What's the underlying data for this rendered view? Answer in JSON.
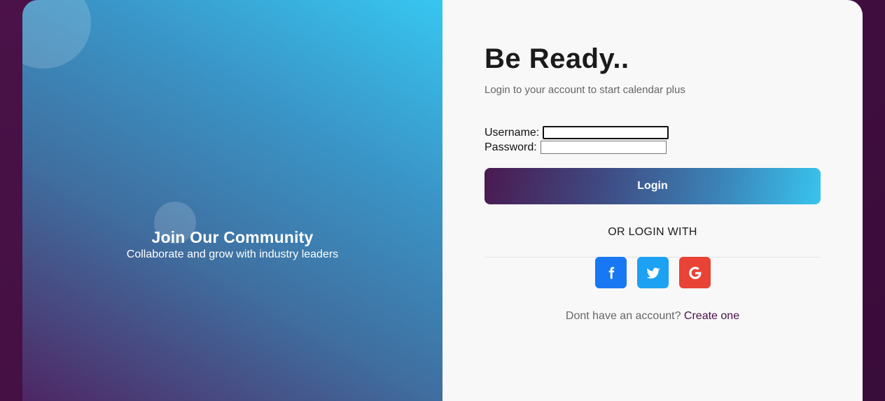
{
  "left_panel": {
    "title": "Join Our Community",
    "subtitle": "Collaborate and grow with industry leaders"
  },
  "right_panel": {
    "heading": "Be Ready..",
    "subheading": "Login to your account to start calendar plus",
    "form": {
      "username_label": "Username:",
      "username_value": "",
      "password_label": "Password:",
      "password_value": ""
    },
    "login_button": "Login",
    "or_label": "OR LOGIN WITH",
    "socials": [
      {
        "name": "facebook",
        "icon": "facebook-icon",
        "color": "#1877f2"
      },
      {
        "name": "twitter",
        "icon": "twitter-icon",
        "color": "#1da1f2"
      },
      {
        "name": "google",
        "icon": "google-icon",
        "color": "#e84335"
      }
    ],
    "footer": {
      "text": "Dont have an account?",
      "link": "Create one"
    }
  },
  "colors": {
    "brand_dark": "#4a1046",
    "brand_light": "#38c4ee",
    "background": "#3a0c3a"
  }
}
